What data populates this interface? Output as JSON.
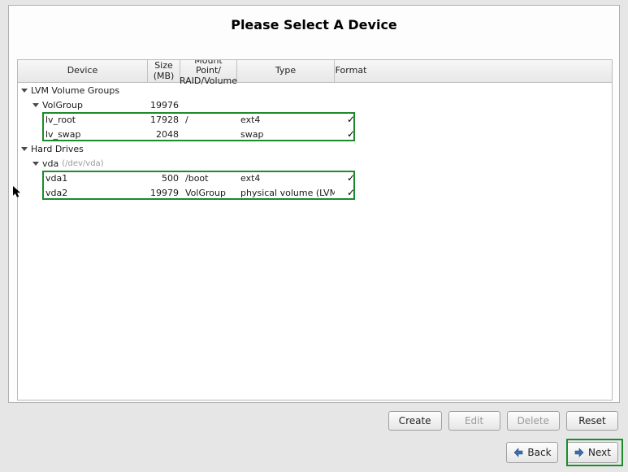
{
  "title": "Please Select A Device",
  "columns": {
    "device": "Device",
    "size_l1": "Size",
    "size_l2": "(MB)",
    "mount_l1": "Mount Point/",
    "mount_l2": "RAID/Volume",
    "type": "Type",
    "format": "Format"
  },
  "groups": {
    "lvm": {
      "label": "LVM Volume Groups",
      "volgroup": {
        "name": "VolGroup",
        "size": "19976"
      },
      "items": [
        {
          "name": "lv_root",
          "size": "17928",
          "mount": "/",
          "type": "ext4",
          "format": true
        },
        {
          "name": "lv_swap",
          "size": "2048",
          "mount": "",
          "type": "swap",
          "format": true
        }
      ]
    },
    "hd": {
      "label": "Hard Drives",
      "disk": {
        "name": "vda",
        "hint": "(/dev/vda)"
      },
      "items": [
        {
          "name": "vda1",
          "size": "500",
          "mount": "/boot",
          "type": "ext4",
          "format": true
        },
        {
          "name": "vda2",
          "size": "19979",
          "mount": "VolGroup",
          "type": "physical volume (LVM)",
          "format": true
        }
      ]
    }
  },
  "actions": {
    "create": "Create",
    "edit": "Edit",
    "delete": "Delete",
    "reset": "Reset"
  },
  "nav": {
    "back": "Back",
    "next": "Next"
  }
}
